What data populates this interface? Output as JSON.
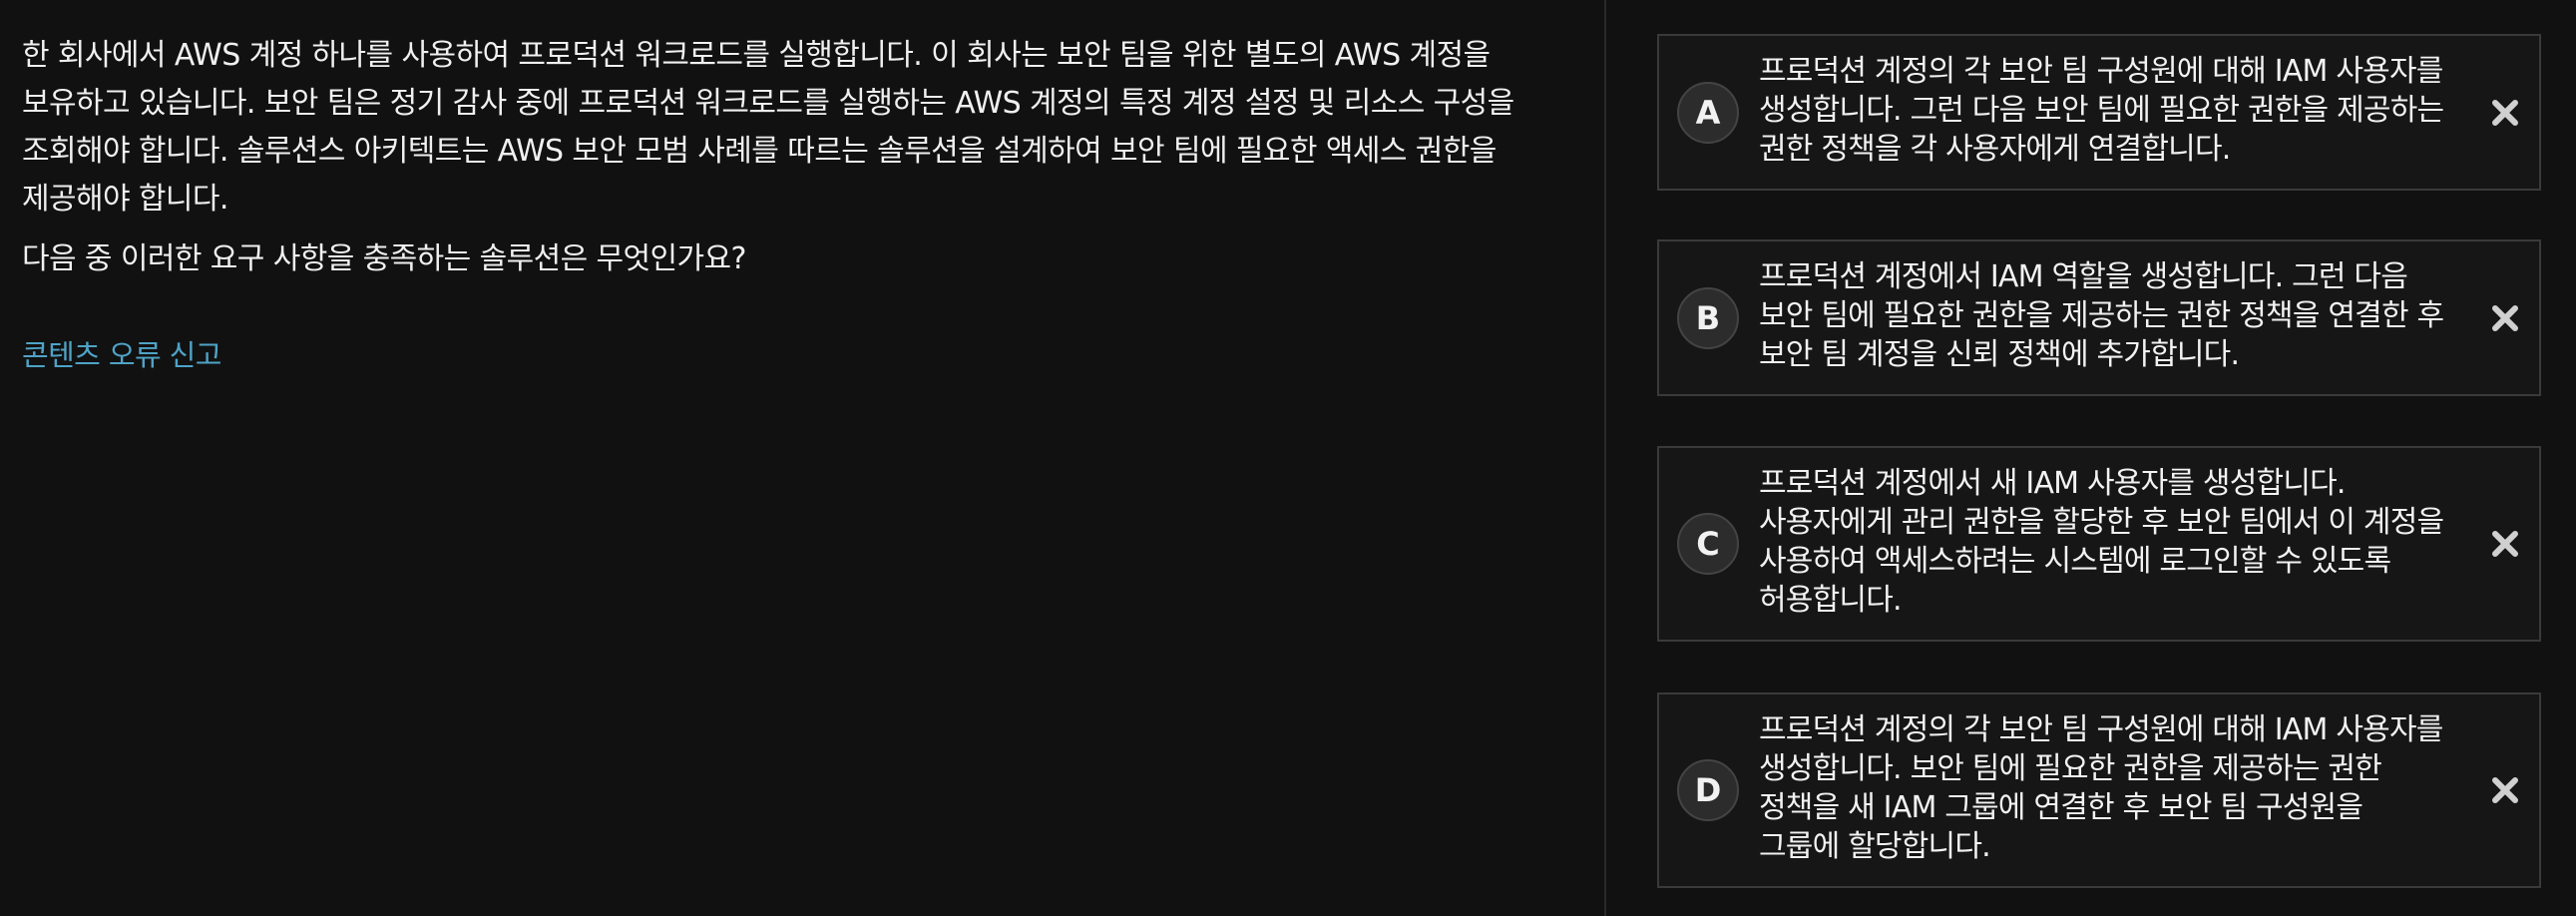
{
  "question": {
    "text": "한 회사에서 AWS 계정 하나를 사용하여 프로덕션 워크로드를 실행합니다. 이 회사는 보안 팀을 위한 별도의 AWS 계정을 보유하고 있습니다. 보안 팀은 정기 감사 중에 프로덕션 워크로드를 실행하는 AWS 계정의 특정 계정 설정 및 리소스 구성을 조회해야 합니다. 솔루션스 아키텍트는 AWS 보안 모범 사례를 따르는 솔루션을 설계하여 보안 팀에 필요한 액세스 권한을 제공해야 합니다.",
    "prompt": "다음 중 이러한 요구 사항을 충족하는 솔루션은 무엇인가요?",
    "report_link": "콘텐츠 오류 신고"
  },
  "options": [
    {
      "letter": "A",
      "text": "프로덕션 계정의 각 보안 팀 구성원에 대해 IAM 사용자를 생성합니다. 그런 다음 보안 팀에 필요한 권한을 제공하는 권한 정책을 각 사용자에게 연결합니다.",
      "close_icon": "x-icon"
    },
    {
      "letter": "B",
      "text": "프로덕션 계정에서 IAM 역할을 생성합니다. 그런 다음 보안 팀에 필요한 권한을 제공하는 권한 정책을 연결한 후 보안 팀 계정을 신뢰 정책에 추가합니다.",
      "close_icon": "x-icon"
    },
    {
      "letter": "C",
      "text": "프로덕션 계정에서 새 IAM 사용자를 생성합니다. 사용자에게 관리 권한을 할당한 후 보안 팀에서 이 계정을 사용하여 액세스하려는 시스템에 로그인할 수 있도록 허용합니다.",
      "close_icon": "x-icon"
    },
    {
      "letter": "D",
      "text": "프로덕션 계정의 각 보안 팀 구성원에 대해 IAM 사용자를 생성합니다. 보안 팀에 필요한 권한을 제공하는 권한 정책을 새 IAM 그룹에 연결한 후 보안 팀 구성원을 그룹에 할당합니다.",
      "close_icon": "x-icon"
    }
  ],
  "colors": {
    "background": "#111111",
    "text": "#f2f2f2",
    "link": "#4fa3c7",
    "option_border": "#3a3a3a",
    "close_icon": "#d0d0d0"
  }
}
